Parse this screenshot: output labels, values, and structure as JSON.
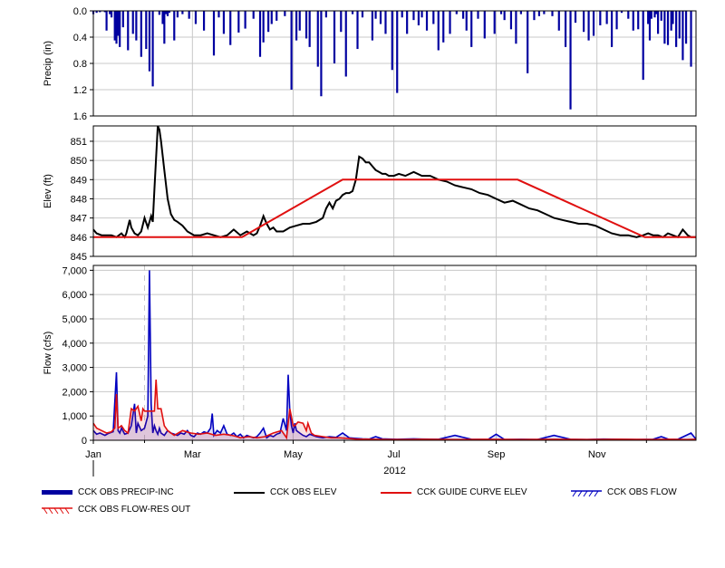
{
  "chart_data": [
    {
      "panel": "precipitation",
      "type": "bar",
      "ylabel": "Precip (in)",
      "yticks": [
        "0.0",
        "0.4",
        "0.8",
        "1.2",
        "1.6"
      ],
      "ylim": [
        1.6,
        0.0
      ],
      "inverted": true,
      "series": [
        {
          "name": "CCK OBS PRECIP-INC",
          "color": "#0000a0",
          "days": [
            1,
            3,
            5,
            8,
            9,
            11,
            12,
            14,
            15,
            16,
            17,
            19,
            22,
            25,
            27,
            30,
            33,
            35,
            37,
            41,
            43,
            44,
            45,
            46,
            47,
            50,
            52,
            55,
            59,
            63,
            68,
            74,
            77,
            80,
            84,
            89,
            93,
            98,
            102,
            104,
            107,
            109,
            112,
            117,
            121,
            124,
            126,
            130,
            132,
            137,
            139,
            142,
            147,
            151,
            154,
            158,
            161,
            164,
            170,
            172,
            175,
            178,
            182,
            185,
            188,
            191,
            195,
            198,
            200,
            203,
            207,
            210,
            213,
            217,
            221,
            225,
            227,
            230,
            234,
            238,
            244,
            248,
            250,
            254,
            257,
            260,
            264,
            268,
            271,
            274,
            279,
            283,
            287,
            290,
            293,
            298,
            301,
            304,
            308,
            312,
            315,
            318,
            321,
            325,
            328,
            331,
            334,
            337,
            338,
            339,
            341,
            342,
            343,
            345,
            347,
            349,
            351,
            352,
            354,
            356,
            358,
            360,
            363
          ],
          "values": [
            0.05,
            0.03,
            0.02,
            0.02,
            0.3,
            0.05,
            0.1,
            0.45,
            0.5,
            0.38,
            0.55,
            0.25,
            0.6,
            0.35,
            0.45,
            0.7,
            0.58,
            0.92,
            1.15,
            0.06,
            0.2,
            0.5,
            0.05,
            0.08,
            0.03,
            0.45,
            0.1,
            0.05,
            0.12,
            0.2,
            0.3,
            0.68,
            0.1,
            0.35,
            0.52,
            0.33,
            0.27,
            0.12,
            0.7,
            0.48,
            0.32,
            0.2,
            0.15,
            0.08,
            1.2,
            0.45,
            0.3,
            0.42,
            0.55,
            0.85,
            1.3,
            0.1,
            0.8,
            0.32,
            1.0,
            0.05,
            0.58,
            0.1,
            0.45,
            0.12,
            0.2,
            0.35,
            0.9,
            1.25,
            0.1,
            0.35,
            0.14,
            0.22,
            0.1,
            0.3,
            0.2,
            0.6,
            0.48,
            0.35,
            0.05,
            0.12,
            0.3,
            0.55,
            0.12,
            0.42,
            0.35,
            0.05,
            0.14,
            0.28,
            0.5,
            0.05,
            0.95,
            0.14,
            0.08,
            0.05,
            0.08,
            0.3,
            0.55,
            1.5,
            0.18,
            0.32,
            0.45,
            0.38,
            0.22,
            0.2,
            0.55,
            0.28,
            0.03,
            0.12,
            0.3,
            0.28,
            1.05,
            0.2,
            0.45,
            0.12,
            0.1,
            0.05,
            0.35,
            0.15,
            0.5,
            0.52,
            0.3,
            0.2,
            0.55,
            0.42,
            0.75,
            0.5,
            0.85,
            0.35,
            0.15,
            0.48
          ]
        }
      ]
    },
    {
      "panel": "elevation",
      "type": "line",
      "ylabel": "Elev (ft)",
      "yticks": [
        "845",
        "846",
        "847",
        "848",
        "849",
        "850",
        "851"
      ],
      "ylim": [
        845,
        851.8
      ],
      "series": [
        {
          "name": "CCK OBS ELEV",
          "color": "#000000",
          "x": [
            1,
            3,
            6,
            9,
            12,
            15,
            18,
            20,
            21,
            23,
            24,
            26,
            28,
            30,
            32,
            34,
            36,
            37,
            38,
            40,
            41,
            42,
            44,
            46,
            48,
            50,
            52,
            55,
            58,
            62,
            66,
            70,
            74,
            78,
            82,
            86,
            90,
            94,
            98,
            100,
            102,
            104,
            106,
            108,
            110,
            112,
            116,
            120,
            124,
            128,
            132,
            136,
            140,
            142,
            144,
            146,
            148,
            150,
            152,
            154,
            156,
            158,
            160,
            162,
            164,
            166,
            168,
            170,
            172,
            174,
            176,
            178,
            180,
            183,
            186,
            190,
            195,
            200,
            205,
            210,
            215,
            220,
            225,
            230,
            235,
            240,
            245,
            250,
            255,
            260,
            265,
            270,
            275,
            280,
            285,
            290,
            295,
            300,
            305,
            310,
            315,
            320,
            325,
            330,
            334,
            337,
            340,
            343,
            346,
            349,
            352,
            355,
            358,
            361,
            363,
            366
          ],
          "y": [
            846.4,
            846.2,
            846.1,
            846.1,
            846.1,
            846.0,
            846.2,
            846.0,
            846.2,
            846.9,
            846.5,
            846.2,
            846.1,
            846.3,
            847.0,
            846.5,
            847.1,
            846.8,
            848.5,
            851.8,
            851.6,
            851.0,
            849.5,
            848.0,
            847.2,
            846.9,
            846.8,
            846.6,
            846.3,
            846.1,
            846.1,
            846.2,
            846.1,
            846.0,
            846.1,
            846.4,
            846.1,
            846.3,
            846.1,
            846.2,
            846.6,
            847.1,
            846.7,
            846.4,
            846.5,
            846.3,
            846.3,
            846.5,
            846.6,
            846.7,
            846.7,
            846.8,
            847.0,
            847.5,
            847.8,
            847.5,
            847.9,
            848.0,
            848.2,
            848.3,
            848.3,
            848.4,
            849.0,
            850.2,
            850.1,
            849.9,
            849.9,
            849.7,
            849.5,
            849.4,
            849.3,
            849.3,
            849.2,
            849.2,
            849.3,
            849.2,
            849.4,
            849.2,
            849.2,
            849.0,
            848.9,
            848.7,
            848.6,
            848.5,
            848.3,
            848.2,
            848.0,
            847.8,
            847.9,
            847.7,
            847.5,
            847.4,
            847.2,
            847.0,
            846.9,
            846.8,
            846.7,
            846.7,
            846.6,
            846.4,
            846.2,
            846.1,
            846.1,
            846.0,
            846.1,
            846.2,
            846.1,
            846.1,
            846.0,
            846.2,
            846.1,
            846.0,
            846.4,
            846.1,
            846.0,
            846.0
          ]
        },
        {
          "name": "CCK GUIDE CURVE ELEV",
          "color": "#e01010",
          "x": [
            1,
            91,
            152,
            258,
            335,
            366
          ],
          "y": [
            846.0,
            846.0,
            849.0,
            849.0,
            846.0,
            846.0
          ]
        }
      ]
    },
    {
      "panel": "flow",
      "type": "line",
      "ylabel": "Flow (cfs)",
      "yticks": [
        "0",
        "1,000",
        "2,000",
        "3,000",
        "4,000",
        "5,000",
        "6,000",
        "7,000"
      ],
      "ylim": [
        0,
        7200
      ],
      "xlabel": "2012",
      "xticks": [
        "Jan",
        "Mar",
        "May",
        "Jul",
        "Sep",
        "Nov"
      ],
      "xtick_days": [
        1,
        61,
        122,
        183,
        245,
        306
      ],
      "minor_tick_days": [
        32,
        92,
        153,
        214,
        275,
        336
      ],
      "xlim": [
        1,
        366
      ],
      "series": [
        {
          "name": "CCK OBS FLOW",
          "color": "#0000c0",
          "x": [
            1,
            3,
            5,
            8,
            10,
            13,
            15,
            16,
            17,
            18,
            20,
            22,
            24,
            26,
            27,
            28,
            30,
            32,
            34,
            35,
            36,
            37,
            38,
            39,
            40,
            41,
            42,
            44,
            46,
            48,
            50,
            52,
            54,
            56,
            58,
            60,
            62,
            64,
            66,
            68,
            70,
            72,
            73,
            74,
            76,
            78,
            80,
            82,
            84,
            86,
            88,
            90,
            92,
            94,
            96,
            98,
            100,
            102,
            104,
            106,
            108,
            110,
            112,
            114,
            116,
            118,
            119,
            120,
            121,
            122,
            123,
            124,
            126,
            128,
            130,
            132,
            134,
            136,
            140,
            144,
            148,
            152,
            156,
            160,
            164,
            168,
            172,
            176,
            180,
            185,
            190,
            195,
            200,
            210,
            220,
            230,
            240,
            245,
            250,
            260,
            270,
            280,
            290,
            300,
            310,
            320,
            330,
            340,
            345,
            350,
            355,
            360,
            363,
            366
          ],
          "y": [
            400,
            250,
            300,
            200,
            280,
            350,
            2800,
            400,
            300,
            500,
            250,
            300,
            600,
            1500,
            300,
            700,
            400,
            500,
            1000,
            7000,
            1500,
            300,
            600,
            400,
            250,
            500,
            300,
            200,
            400,
            300,
            250,
            200,
            300,
            250,
            400,
            200,
            150,
            300,
            250,
            350,
            300,
            500,
            1100,
            200,
            400,
            300,
            600,
            250,
            200,
            300,
            150,
            250,
            100,
            200,
            150,
            100,
            150,
            300,
            500,
            100,
            200,
            150,
            250,
            300,
            900,
            400,
            2700,
            1200,
            600,
            300,
            700,
            400,
            300,
            200,
            150,
            250,
            200,
            150,
            100,
            150,
            120,
            300,
            100,
            80,
            60,
            50,
            150,
            60,
            50,
            40,
            50,
            60,
            50,
            40,
            200,
            40,
            30,
            250,
            30,
            40,
            30,
            200,
            40,
            30,
            50,
            40,
            30,
            40,
            150,
            30,
            40,
            200,
            300,
            40
          ]
        },
        {
          "name": "CCK OBS FLOW-RES OUT",
          "color": "#e01010",
          "x": [
            1,
            3,
            6,
            9,
            12,
            14,
            15,
            16,
            18,
            20,
            22,
            24,
            26,
            28,
            30,
            31,
            32,
            34,
            36,
            38,
            39,
            40,
            41,
            42,
            44,
            46,
            48,
            50,
            55,
            60,
            65,
            70,
            75,
            80,
            85,
            88,
            90,
            95,
            100,
            105,
            110,
            115,
            118,
            120,
            122,
            123,
            125,
            128,
            130,
            131,
            133,
            135,
            140,
            145,
            150,
            155,
            160,
            170,
            180,
            190,
            200,
            220,
            240,
            260,
            280,
            300,
            320,
            340,
            350,
            360,
            366
          ],
          "y": [
            700,
            500,
            400,
            300,
            350,
            500,
            1900,
            500,
            600,
            400,
            300,
            1300,
            1200,
            1400,
            800,
            1300,
            1200,
            1200,
            1200,
            1200,
            2500,
            1300,
            1300,
            1300,
            600,
            400,
            300,
            200,
            400,
            300,
            250,
            300,
            200,
            250,
            200,
            150,
            100,
            150,
            100,
            150,
            300,
            400,
            100,
            1300,
            600,
            600,
            750,
            700,
            400,
            700,
            300,
            200,
            150,
            100,
            100,
            80,
            50,
            40,
            30,
            30,
            40,
            30,
            40,
            30,
            40,
            30,
            40,
            30,
            40,
            30,
            40
          ]
        }
      ]
    }
  ],
  "legend": {
    "items": [
      {
        "name": "CCK OBS PRECIP-INC",
        "color": "#0000a0",
        "style": "bar"
      },
      {
        "name": "CCK OBS ELEV",
        "color": "#000000",
        "style": "line"
      },
      {
        "name": "CCK GUIDE CURVE ELEV",
        "color": "#e01010",
        "style": "line"
      },
      {
        "name": "CCK OBS FLOW",
        "color": "#0000c0",
        "style": "hatch"
      },
      {
        "name": "CCK OBS FLOW-RES OUT",
        "color": "#e01010",
        "style": "hatch"
      }
    ]
  }
}
